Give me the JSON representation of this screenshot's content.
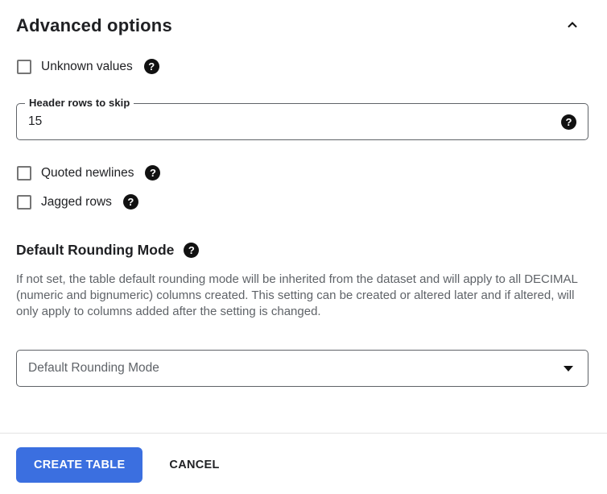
{
  "section": {
    "title": "Advanced options"
  },
  "options": [
    {
      "label": "Unknown values",
      "checked": false
    },
    {
      "label": "Quoted newlines",
      "checked": false
    },
    {
      "label": "Jagged rows",
      "checked": false
    }
  ],
  "header_rows_field": {
    "label": "Header rows to skip",
    "value": "15"
  },
  "rounding": {
    "heading": "Default Rounding Mode",
    "description": "If not set, the table default rounding mode will be inherited from the dataset and will apply to all DECIMAL (numeric and bignumeric) columns created. This setting can be created or altered later and if altered, will only apply to columns added after the setting is changed.",
    "select_placeholder": "Default Rounding Mode"
  },
  "actions": {
    "create_label": "CREATE TABLE",
    "cancel_label": "CANCEL"
  },
  "icons": {
    "help_glyph": "?"
  },
  "colors": {
    "primary_button": "#3b6fe0",
    "text_primary": "#202124",
    "text_secondary": "#5f6368",
    "field_border": "#5f6368",
    "divider": "#e3e3e3"
  }
}
